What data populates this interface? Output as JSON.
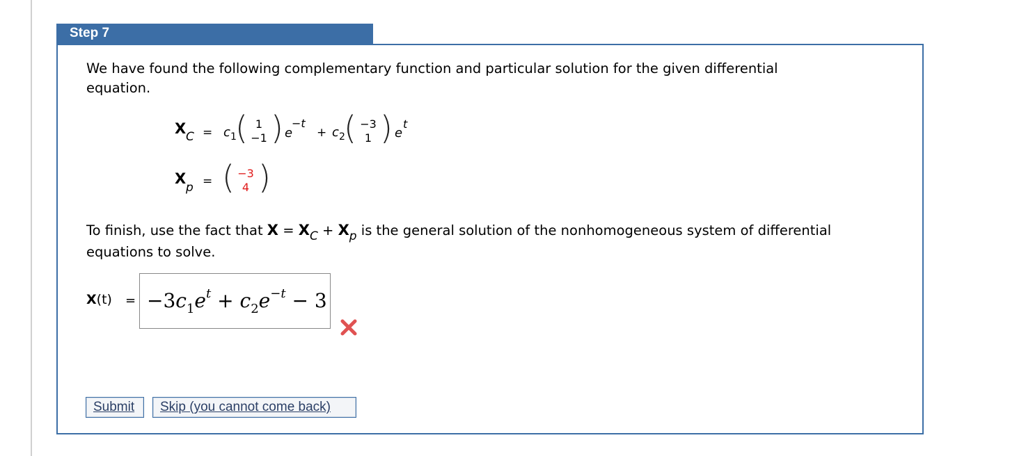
{
  "step": {
    "title": "Step 7"
  },
  "intro": {
    "line1": "We have found the following complementary function and particular solution for the given differential",
    "line2": "equation."
  },
  "eq_xc": {
    "lhs_symbol": "X",
    "lhs_sub": "C",
    "equals": "=",
    "c1": "c",
    "c1_sub": "1",
    "vec1": [
      "1",
      "−1"
    ],
    "exp1_base": "e",
    "exp1_power": "−t",
    "plus": "+",
    "c2": "c",
    "c2_sub": "2",
    "vec2": [
      "−3",
      "1"
    ],
    "exp2_base": "e",
    "exp2_power": "t"
  },
  "eq_xp": {
    "lhs_symbol": "X",
    "lhs_sub": "p",
    "equals": "=",
    "vec": [
      "−3",
      "4"
    ],
    "vec_color": "#e01b1b"
  },
  "finish": {
    "part1": "To finish, use the fact that ",
    "x": "X",
    "eq": " = ",
    "xc": "X",
    "xc_sub": "C",
    "plus": " + ",
    "xp": "X",
    "xp_sub": "p",
    "part2": " is the general solution of the nonhomogeneous system of differential",
    "line2": "equations to solve."
  },
  "answer": {
    "label_x": "X",
    "label_t": "(t)",
    "equals": "=",
    "m1": "−3",
    "c": "c",
    "sub1": "1",
    "e": "e",
    "sup1": "t",
    "plus": "+",
    "sub2": "2",
    "sup2": "−t",
    "minus": "−",
    "three": "3",
    "status": "incorrect",
    "status_icon": "x-mark-icon",
    "status_color": "#e05252"
  },
  "buttons": {
    "submit": "Submit",
    "skip": "Skip (you cannot come back)"
  }
}
